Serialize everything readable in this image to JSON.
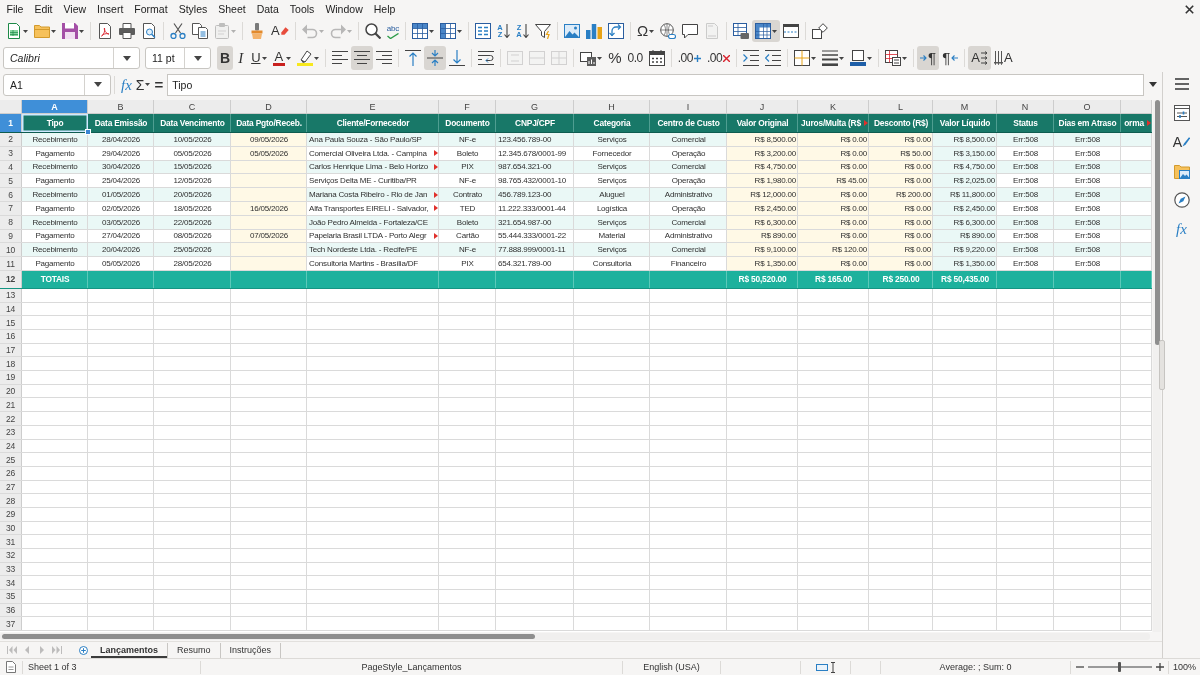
{
  "menu_bar": [
    "File",
    "Edit",
    "View",
    "Insert",
    "Format",
    "Styles",
    "Sheet",
    "Data",
    "Tools",
    "Window",
    "Help"
  ],
  "standard_toolbar": [
    {
      "pressed": false,
      "disabled": false
    },
    {
      "pressed": false,
      "disabled": false
    },
    {
      "pressed": false,
      "disabled": false
    },
    {
      "pressed": false,
      "disabled": false
    },
    {
      "pressed": false,
      "disabled": false
    },
    {
      "pressed": false,
      "disabled": false
    },
    {
      "pressed": false,
      "disabled": false
    },
    {
      "pressed": false,
      "disabled": false
    },
    {
      "pressed": false,
      "disabled": true
    },
    {
      "pressed": false,
      "disabled": false
    },
    {
      "glyph": "A",
      "pressed": false,
      "disabled": false
    },
    {
      "pressed": false,
      "disabled": true
    },
    {
      "pressed": false,
      "disabled": true
    },
    {
      "pressed": false,
      "disabled": false
    },
    {
      "glyph": "abc",
      "pressed": false,
      "disabled": false
    },
    {
      "pressed": false,
      "disabled": false
    },
    {
      "pressed": false,
      "disabled": false
    },
    {
      "pressed": false,
      "disabled": false
    },
    {
      "glyph": "AZ",
      "pressed": false,
      "disabled": false
    },
    {
      "glyph": "ZA",
      "pressed": false,
      "disabled": false
    },
    {
      "pressed": false,
      "disabled": false
    },
    {
      "pressed": false,
      "disabled": false
    },
    {
      "pressed": false,
      "disabled": false
    },
    {
      "pressed": false,
      "disabled": false
    },
    {
      "glyph": "Ω",
      "pressed": false,
      "disabled": false
    },
    {
      "pressed": false,
      "disabled": false
    },
    {
      "pressed": false,
      "disabled": false
    },
    {
      "pressed": false,
      "disabled": true
    },
    {
      "pressed": false,
      "disabled": false
    },
    {
      "pressed": true,
      "disabled": false
    },
    {
      "pressed": false,
      "disabled": false
    },
    {
      "pressed": false,
      "disabled": false
    }
  ],
  "formatting_toolbar": {
    "font_name": "Calibri",
    "font_size": "11 pt",
    "buttons": [
      {
        "glyph": "B",
        "pressed": true,
        "disabled": false
      },
      {
        "glyph": "I",
        "pressed": false,
        "disabled": false
      },
      {
        "glyph": "U",
        "pressed": false,
        "disabled": false
      },
      {
        "glyph": "A",
        "pressed": false,
        "disabled": false
      },
      {
        "pressed": false,
        "disabled": false
      },
      {
        "pressed": false,
        "disabled": false
      },
      {
        "pressed": true,
        "disabled": false
      },
      {
        "pressed": false,
        "disabled": false
      },
      {
        "pressed": false,
        "disabled": false
      },
      {
        "pressed": true,
        "disabled": false
      },
      {
        "pressed": false,
        "disabled": false
      },
      {
        "pressed": false,
        "disabled": false
      },
      {
        "pressed": false,
        "disabled": true
      },
      {
        "pressed": false,
        "disabled": true
      },
      {
        "pressed": false,
        "disabled": true
      },
      {
        "pressed": false,
        "disabled": false
      },
      {
        "glyph": "%",
        "pressed": false,
        "disabled": false
      },
      {
        "glyph": "0.0",
        "pressed": false,
        "disabled": false
      },
      {
        "pressed": false,
        "disabled": false
      },
      {
        "glyph": ".00",
        "pressed": false,
        "disabled": false
      },
      {
        "glyph": ".00",
        "pressed": false,
        "disabled": false
      },
      {
        "pressed": false,
        "disabled": false
      },
      {
        "pressed": false,
        "disabled": false
      },
      {
        "pressed": false,
        "disabled": false
      },
      {
        "pressed": false,
        "disabled": false
      },
      {
        "pressed": false,
        "disabled": false
      },
      {
        "pressed": false,
        "disabled": false
      },
      {
        "glyph": "¶",
        "pressed": true,
        "disabled": false
      },
      {
        "glyph": "¶",
        "pressed": false,
        "disabled": false
      },
      {
        "glyph": "A",
        "pressed": true,
        "disabled": false
      },
      {
        "glyph": "A",
        "pressed": false,
        "disabled": false
      }
    ]
  },
  "formula_bar": {
    "name_box": "A1",
    "function_wizard": "fx",
    "sum": "Σ",
    "equals": "=",
    "formula": "Tipo"
  },
  "sidebar": {
    "styles": "A",
    "functions": "fx"
  },
  "sheet": {
    "columns": [
      {
        "letter": "A",
        "selected": true
      },
      {
        "letter": "B",
        "selected": false
      },
      {
        "letter": "C",
        "selected": false
      },
      {
        "letter": "D",
        "selected": false
      },
      {
        "letter": "E",
        "selected": false
      },
      {
        "letter": "F",
        "selected": false
      },
      {
        "letter": "G",
        "selected": false
      },
      {
        "letter": "H",
        "selected": false
      },
      {
        "letter": "I",
        "selected": false
      },
      {
        "letter": "J",
        "selected": false
      },
      {
        "letter": "K",
        "selected": false
      },
      {
        "letter": "L",
        "selected": false
      },
      {
        "letter": "M",
        "selected": false
      },
      {
        "letter": "N",
        "selected": false
      },
      {
        "letter": "O",
        "selected": false
      },
      {
        "selected": false
      }
    ],
    "rows": [
      {
        "number": "1",
        "selected": true,
        "kind": "header",
        "tipo": "Tipo",
        "data_emissao": "Data Emissão",
        "data_vencimento": "Data Vencimento",
        "data_pgto_receb": "Data Pgto/Receb.",
        "cliente_fornecedor": "Cliente/Fornecedor",
        "documento": "Documento",
        "cnpj_cpf": "CNPJ/CPF",
        "categoria": "Categoria",
        "centro_de_custo": "Centro de Custo",
        "valor_original": "Valor Original",
        "juros_multa": {
          "text": "Juros/Multa (R$",
          "clipped": true
        },
        "desconto": "Desconto (R$)",
        "valor_liquido": "Valor Líquido",
        "status": "Status",
        "dias_em_atraso": "Dias em Atraso",
        "column_16": {
          "text": "orma",
          "clipped": true
        }
      },
      {
        "number": "2",
        "selected": false,
        "kind": "data",
        "tipo": "Recebimento",
        "data_emissao": "28/04/2026",
        "data_vencimento": "10/05/2026",
        "data_pgto_receb": "09/05/2026",
        "cliente_fornecedor": "Ana Paula Souza - São Paulo/SP",
        "documento": "NF-e",
        "cnpj_cpf": "123.456.789-00",
        "categoria": "Serviços",
        "centro_de_custo": "Comercial",
        "valor_original": "R$ 8,500.00",
        "juros_multa": "R$ 0.00",
        "desconto": "R$ 0.00",
        "valor_liquido": "R$ 8,500.00",
        "status": "Err:508",
        "dias_em_atraso": "Err:508"
      },
      {
        "number": "3",
        "selected": false,
        "kind": "data",
        "tipo": "Pagamento",
        "data_emissao": "29/04/2026",
        "data_vencimento": "05/05/2026",
        "data_pgto_receb": "05/05/2026",
        "cliente_fornecedor": {
          "text": "Comercial Oliveira Ltda. - Campina",
          "clipped": true
        },
        "documento": "Boleto",
        "cnpj_cpf": "12.345.678/0001-99",
        "categoria": "Fornecedor",
        "centro_de_custo": "Operação",
        "valor_original": "R$ 3,200.00",
        "juros_multa": "R$ 0.00",
        "desconto": "R$ 50.00",
        "valor_liquido": "R$ 3,150.00",
        "status": "Err:508",
        "dias_em_atraso": "Err:508"
      },
      {
        "number": "4",
        "selected": false,
        "kind": "data",
        "tipo": "Recebimento",
        "data_emissao": "30/04/2026",
        "data_vencimento": "15/05/2026",
        "cliente_fornecedor": {
          "text": "Carlos Henrique Lima - Belo Horizo",
          "clipped": true
        },
        "documento": "PIX",
        "cnpj_cpf": "987.654.321-00",
        "categoria": "Serviços",
        "centro_de_custo": "Comercial",
        "valor_original": "R$ 4,750.00",
        "juros_multa": "R$ 0.00",
        "desconto": "R$ 0.00",
        "valor_liquido": "R$ 4,750.00",
        "status": "Err:508",
        "dias_em_atraso": "Err:508"
      },
      {
        "number": "5",
        "selected": false,
        "kind": "data",
        "tipo": "Pagamento",
        "data_emissao": "25/04/2026",
        "data_vencimento": "12/05/2026",
        "cliente_fornecedor": "Serviços Delta ME - Curitiba/PR",
        "documento": "NF-e",
        "cnpj_cpf": "98.765.432/0001-10",
        "categoria": "Serviços",
        "centro_de_custo": "Operação",
        "valor_original": "R$ 1,980.00",
        "juros_multa": "R$ 45.00",
        "desconto": "R$ 0.00",
        "valor_liquido": "R$ 2,025.00",
        "status": "Err:508",
        "dias_em_atraso": "Err:508"
      },
      {
        "number": "6",
        "selected": false,
        "kind": "data",
        "tipo": "Recebimento",
        "data_emissao": "01/05/2026",
        "data_vencimento": "20/05/2026",
        "cliente_fornecedor": {
          "text": "Mariana Costa Ribeiro - Rio de Jan",
          "clipped": true
        },
        "documento": "Contrato",
        "cnpj_cpf": "456.789.123-00",
        "categoria": "Aluguel",
        "centro_de_custo": "Administrativo",
        "valor_original": "R$ 12,000.00",
        "juros_multa": "R$ 0.00",
        "desconto": "R$ 200.00",
        "valor_liquido": "R$ 11,800.00",
        "status": "Err:508",
        "dias_em_atraso": "Err:508"
      },
      {
        "number": "7",
        "selected": false,
        "kind": "data",
        "tipo": "Pagamento",
        "data_emissao": "02/05/2026",
        "data_vencimento": "18/05/2026",
        "data_pgto_receb": "16/05/2026",
        "cliente_fornecedor": {
          "text": "Alfa Transportes EIRELI - Salvador,",
          "clipped": true
        },
        "documento": "TED",
        "cnpj_cpf": "11.222.333/0001-44",
        "categoria": "Logística",
        "centro_de_custo": "Operação",
        "valor_original": "R$ 2,450.00",
        "juros_multa": "R$ 0.00",
        "desconto": "R$ 0.00",
        "valor_liquido": "R$ 2,450.00",
        "status": "Err:508",
        "dias_em_atraso": "Err:508"
      },
      {
        "number": "8",
        "selected": false,
        "kind": "data",
        "tipo": "Recebimento",
        "data_emissao": "03/05/2026",
        "data_vencimento": "22/05/2026",
        "cliente_fornecedor": "João Pedro Almeida - Fortaleza/CE",
        "documento": "Boleto",
        "cnpj_cpf": "321.654.987-00",
        "categoria": "Serviços",
        "centro_de_custo": "Comercial",
        "valor_original": "R$ 6,300.00",
        "juros_multa": "R$ 0.00",
        "desconto": "R$ 0.00",
        "valor_liquido": "R$ 6,300.00",
        "status": "Err:508",
        "dias_em_atraso": "Err:508"
      },
      {
        "number": "9",
        "selected": false,
        "kind": "data",
        "tipo": "Pagamento",
        "data_emissao": "27/04/2026",
        "data_vencimento": "08/05/2026",
        "data_pgto_receb": "07/05/2026",
        "cliente_fornecedor": {
          "text": "Papelaria Brasil LTDA - Porto Alegr",
          "clipped": true
        },
        "documento": "Cartão",
        "cnpj_cpf": "55.444.333/0001-22",
        "categoria": "Material",
        "centro_de_custo": "Administrativo",
        "valor_original": "R$ 890.00",
        "juros_multa": "R$ 0.00",
        "desconto": "R$ 0.00",
        "valor_liquido": "R$ 890.00",
        "status": "Err:508",
        "dias_em_atraso": "Err:508"
      },
      {
        "number": "10",
        "selected": false,
        "kind": "data",
        "tipo": "Recebimento",
        "data_emissao": "20/04/2026",
        "data_vencimento": "25/05/2026",
        "cliente_fornecedor": "Tech Nordeste Ltda. - Recife/PE",
        "documento": "NF-e",
        "cnpj_cpf": "77.888.999/0001-11",
        "categoria": "Serviços",
        "centro_de_custo": "Comercial",
        "valor_original": "R$ 9,100.00",
        "juros_multa": "R$ 120.00",
        "desconto": "R$ 0.00",
        "valor_liquido": "R$ 9,220.00",
        "status": "Err:508",
        "dias_em_atraso": "Err:508"
      },
      {
        "number": "11",
        "selected": false,
        "kind": "data",
        "tipo": "Pagamento",
        "data_emissao": "05/05/2026",
        "data_vencimento": "28/05/2026",
        "cliente_fornecedor": "Consultoria Martins - Brasília/DF",
        "documento": "PIX",
        "cnpj_cpf": "654.321.789-00",
        "categoria": "Consultoria",
        "centro_de_custo": "Financeiro",
        "valor_original": "R$ 1,350.00",
        "juros_multa": "R$ 0.00",
        "desconto": "R$ 0.00",
        "valor_liquido": "R$ 1,350.00",
        "status": "Err:508",
        "dias_em_atraso": "Err:508"
      },
      {
        "number": "12",
        "selected": false,
        "kind": "total",
        "tipo": "TOTAIS",
        "valor_original": "R$ 50,520.00",
        "juros_multa": "R$ 165.00",
        "desconto": "R$ 250.00",
        "valor_liquido": "R$ 50,435.00"
      },
      {
        "number": "13",
        "selected": false,
        "kind": "empty"
      },
      {
        "number": "14",
        "selected": false,
        "kind": "empty"
      },
      {
        "number": "15",
        "selected": false,
        "kind": "empty"
      },
      {
        "number": "16",
        "selected": false,
        "kind": "empty"
      },
      {
        "number": "17",
        "selected": false,
        "kind": "empty"
      },
      {
        "number": "18",
        "selected": false,
        "kind": "empty"
      },
      {
        "number": "19",
        "selected": false,
        "kind": "empty"
      },
      {
        "number": "20",
        "selected": false,
        "kind": "empty"
      },
      {
        "number": "21",
        "selected": false,
        "kind": "empty"
      },
      {
        "number": "22",
        "selected": false,
        "kind": "empty"
      },
      {
        "number": "23",
        "selected": false,
        "kind": "empty"
      },
      {
        "number": "24",
        "selected": false,
        "kind": "empty"
      },
      {
        "number": "25",
        "selected": false,
        "kind": "empty"
      },
      {
        "number": "26",
        "selected": false,
        "kind": "empty"
      },
      {
        "number": "27",
        "selected": false,
        "kind": "empty"
      },
      {
        "number": "28",
        "selected": false,
        "kind": "empty"
      },
      {
        "number": "29",
        "selected": false,
        "kind": "empty"
      },
      {
        "number": "30",
        "selected": false,
        "kind": "empty"
      },
      {
        "number": "31",
        "selected": false,
        "kind": "empty"
      },
      {
        "number": "32",
        "selected": false,
        "kind": "empty"
      },
      {
        "number": "33",
        "selected": false,
        "kind": "empty"
      },
      {
        "number": "34",
        "selected": false,
        "kind": "empty"
      },
      {
        "number": "35",
        "selected": false,
        "kind": "empty"
      },
      {
        "number": "36",
        "selected": false,
        "kind": "empty"
      },
      {
        "number": "37",
        "selected": false,
        "kind": "empty"
      }
    ]
  },
  "sheet_navigation": [
    {
      "disabled": true
    },
    {
      "disabled": true
    },
    {
      "disabled": true
    },
    {
      "disabled": true
    }
  ],
  "sheet_tabs": [
    {
      "label": "Lançamentos",
      "selected": true
    },
    {
      "label": "Resumo",
      "selected": false
    },
    {
      "label": "Instruções",
      "selected": false
    }
  ],
  "status_bar": {
    "sheet": "Sheet 1 of 3",
    "page_style": "PageStyle_Lançamentos",
    "language": "English (USA)",
    "summary": "Average: ; Sum: 0",
    "zoom": {
      "level": 0.5,
      "reading": "100%"
    }
  }
}
